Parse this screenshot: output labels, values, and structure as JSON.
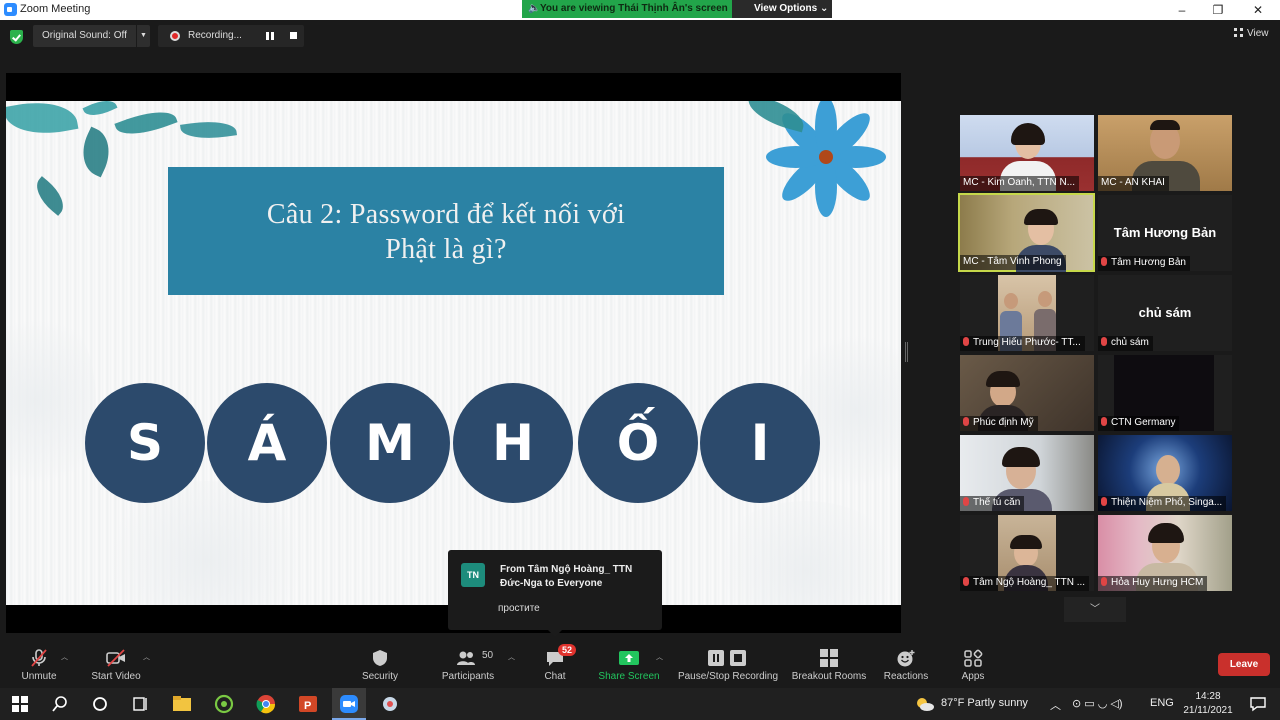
{
  "window": {
    "title": "Zoom Meeting",
    "banner": "You are viewing Thái Thịnh Ân's screen",
    "view_options": "View Options ⌄"
  },
  "topbar": {
    "original_sound": "Original Sound: Off",
    "recording": "Recording...",
    "view": "View"
  },
  "slide": {
    "question_line1": "Câu 2: Password để kết nối với",
    "question_line2": "Phật là gì?",
    "letters": [
      "S",
      "Á",
      "M",
      "H",
      "Ố",
      "I"
    ]
  },
  "chat_popup": {
    "initials": "TN",
    "from": "From Tâm Ngộ Hoàng_ TTN Đức-Nga to Everyone",
    "message": "простите"
  },
  "gallery": [
    {
      "name": "MC - Kim Oanh, TTN N...",
      "muted": false
    },
    {
      "name": "MC - AN KHAI",
      "muted": false
    },
    {
      "name": "MC - Tâm Vinh Phong",
      "muted": false,
      "active": true
    },
    {
      "name": "Tâm Hương Bản",
      "display_name": "Tâm Hương Bản",
      "muted": true
    },
    {
      "name": "Trung Hiếu Phước- TT...",
      "muted": true
    },
    {
      "name": "chủ sám",
      "display_name": "chủ sám",
      "muted": true
    },
    {
      "name": "Phúc định Mỹ",
      "muted": true
    },
    {
      "name": "CTN Germany",
      "muted": true
    },
    {
      "name": "Thế tú căn",
      "muted": true
    },
    {
      "name": "Thiện Niệm Phố, Singa...",
      "muted": true
    },
    {
      "name": "Tâm Ngộ Hoàng_ TTN ...",
      "muted": true
    },
    {
      "name": "Hỏa Huy Hưng HCM",
      "muted": true
    }
  ],
  "toolbar": {
    "unmute": "Unmute",
    "start_video": "Start Video",
    "security": "Security",
    "participants": "Participants",
    "participants_count": "50",
    "chat": "Chat",
    "chat_badge": "52",
    "share_screen": "Share Screen",
    "pause_stop_recording": "Pause/Stop Recording",
    "breakout_rooms": "Breakout Rooms",
    "reactions": "Reactions",
    "apps": "Apps",
    "leave": "Leave"
  },
  "taskbar": {
    "weather": "87°F  Partly sunny",
    "language": "ENG",
    "time": "14:28",
    "date": "21/11/2021"
  },
  "colors": {
    "share_green": "#22c55e",
    "leave_red": "#c9302c",
    "slide_blue": "#2b82a4",
    "circle_navy": "#2c4a6c",
    "active_speaker": "#c6d84a"
  }
}
